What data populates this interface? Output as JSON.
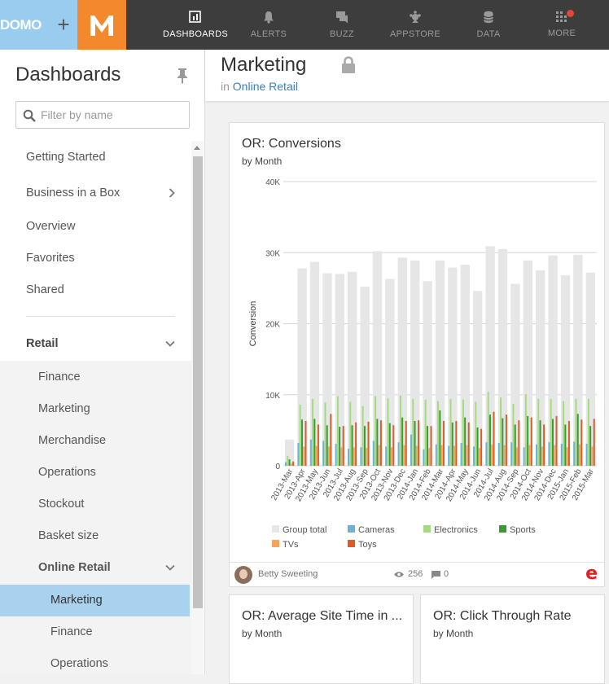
{
  "topbar": {
    "logo_domo": "DOMO",
    "logo_plus": "+",
    "logo_m": "M",
    "nav": [
      {
        "label": "DASHBOARDS",
        "icon": "dashboards-icon",
        "active": true
      },
      {
        "label": "ALERTS",
        "icon": "bell-icon",
        "active": false
      },
      {
        "label": "BUZZ",
        "icon": "chat-icon",
        "active": false
      },
      {
        "label": "APPSTORE",
        "icon": "appstore-icon",
        "active": false
      },
      {
        "label": "DATA",
        "icon": "database-icon",
        "active": false
      },
      {
        "label": "MORE",
        "icon": "grid-icon",
        "active": false
      }
    ]
  },
  "sidebar": {
    "title": "Dashboards",
    "filter_placeholder": "Filter by name",
    "items": [
      {
        "label": "Getting Started"
      },
      {
        "label": "Business in a Box"
      },
      {
        "label": "Overview"
      },
      {
        "label": "Favorites"
      },
      {
        "label": "Shared"
      }
    ],
    "retail": {
      "label": "Retail",
      "children": [
        "Finance",
        "Marketing",
        "Merchandise",
        "Operations",
        "Stockout",
        "Basket size"
      ],
      "online_retail": {
        "label": "Online Retail",
        "children": [
          "Marketing",
          "Finance",
          "Operations"
        ],
        "active_index": 0
      }
    }
  },
  "page": {
    "title": "Marketing",
    "crumb_prefix": "in",
    "crumb_link": "Online Retail"
  },
  "cards": {
    "conversions": {
      "title": "OR: Conversions",
      "subtitle": "by Month",
      "owner": "Betty Sweeting",
      "views": "256",
      "comments": "0"
    },
    "site_time": {
      "title": "OR: Average Site Time in ...",
      "subtitle": "by Month"
    },
    "ctr": {
      "title": "OR: Click Through Rate",
      "subtitle": "by Month"
    }
  },
  "colors": {
    "group_total": "#e6e6e6",
    "cameras": "#6bb1d9",
    "electronics": "#a2dc7d",
    "sports": "#3b9a34",
    "tvs": "#f5a45c",
    "toys": "#e05a27",
    "accent_blue": "#a9d2ee",
    "domo_blue": "#99ccee",
    "brand_orange": "#f4882c"
  },
  "chart_data": {
    "type": "bar",
    "ylabel": "Conversion",
    "ylim": [
      0,
      40000
    ],
    "yticks": [
      "0",
      "10K",
      "20K",
      "30K",
      "40K"
    ],
    "categories": [
      "2013-Mar",
      "2013-Apr",
      "2013-May",
      "2013-Jun",
      "2013-Jul",
      "2013-Aug",
      "2013-Sep",
      "2013-Oct",
      "2013-Nov",
      "2013-Dec",
      "2014-Jan",
      "2014-Feb",
      "2014-Mar",
      "2014-Apr",
      "2014-May",
      "2014-Jun",
      "2014-Jul",
      "2014-Aug",
      "2014-Sep",
      "2014-Oct",
      "2014-Nov",
      "2014-Dec",
      "2015-Jan",
      "2015-Feb",
      "2015-Mar"
    ],
    "series": [
      {
        "name": "Group total",
        "values": [
          3700,
          27800,
          28700,
          27100,
          27000,
          27300,
          25200,
          30200,
          26300,
          29300,
          28900,
          26000,
          28900,
          27900,
          28300,
          24600,
          30900,
          30500,
          25600,
          28900,
          27500,
          29600,
          26800,
          29700,
          27200
        ]
      },
      {
        "name": "Cameras",
        "values": [
          500,
          3200,
          3700,
          3500,
          3100,
          2400,
          2600,
          3500,
          2700,
          3300,
          4400,
          2300,
          3000,
          2800,
          3200,
          2700,
          3300,
          3200,
          3300,
          2600,
          3000,
          3300,
          3100,
          3400,
          3100
        ]
      },
      {
        "name": "Electronics",
        "values": [
          1400,
          8600,
          9400,
          8900,
          9800,
          9000,
          8400,
          9800,
          9500,
          9900,
          9400,
          9300,
          9100,
          9400,
          9300,
          9000,
          10400,
          9600,
          8700,
          10100,
          9400,
          9400,
          9100,
          9400,
          9400
        ]
      },
      {
        "name": "Sports",
        "values": [
          900,
          6500,
          6600,
          5700,
          5500,
          5700,
          5600,
          6600,
          6000,
          6800,
          6300,
          5600,
          7800,
          6100,
          6800,
          5400,
          7200,
          6700,
          5800,
          7000,
          6400,
          6600,
          5800,
          7300,
          5600
        ]
      },
      {
        "name": "TVs",
        "values": [
          300,
          2700,
          2800,
          2700,
          2600,
          2600,
          2500,
          2900,
          2600,
          2900,
          2800,
          2500,
          2900,
          2800,
          2900,
          2500,
          3000,
          2900,
          2600,
          2900,
          2700,
          2900,
          2600,
          3000,
          2700
        ]
      },
      {
        "name": "Toys",
        "values": [
          600,
          6300,
          5800,
          7300,
          5600,
          6100,
          6200,
          6400,
          5700,
          6300,
          6400,
          5600,
          6300,
          6300,
          6100,
          5200,
          7600,
          7200,
          6400,
          6800,
          5800,
          7000,
          6300,
          6500,
          6600
        ]
      }
    ],
    "legend": [
      "Group total",
      "Cameras",
      "Electronics",
      "Sports",
      "TVs",
      "Toys"
    ],
    "legend_position": "bottom",
    "grid": true
  }
}
